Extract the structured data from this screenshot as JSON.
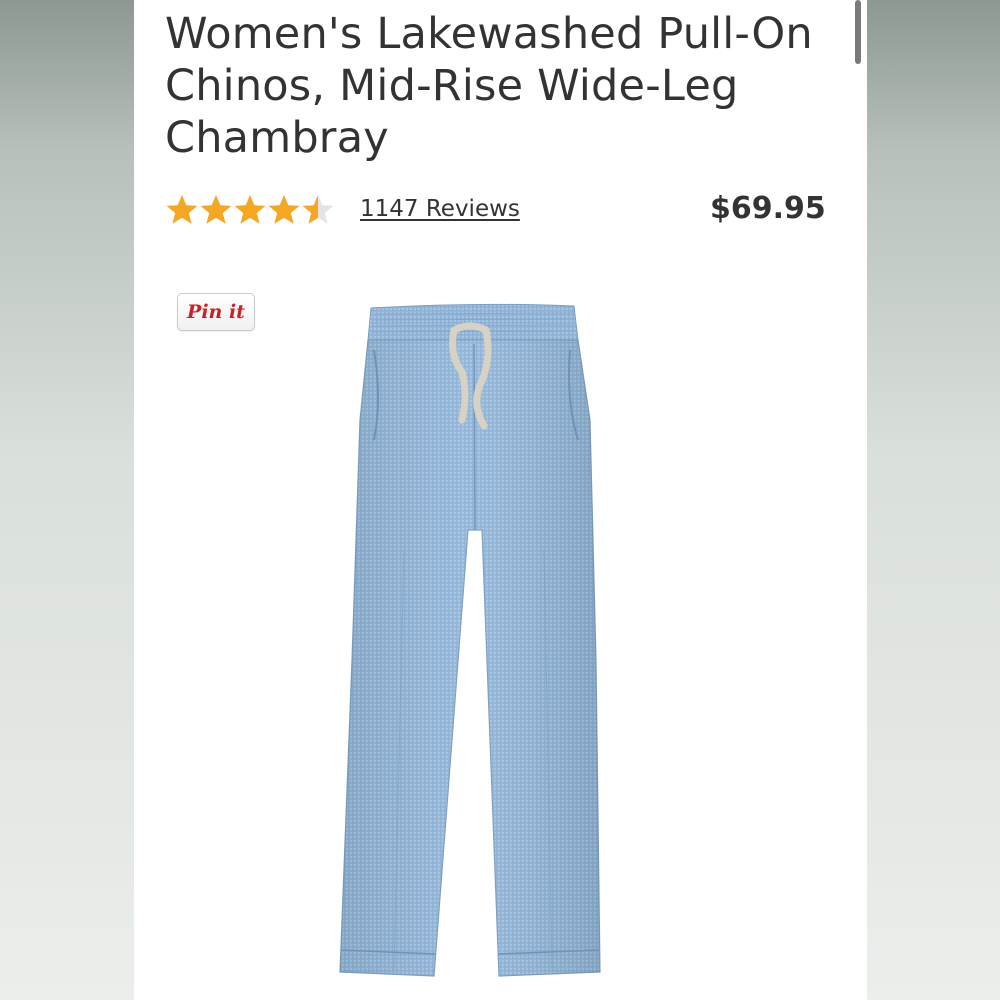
{
  "product": {
    "title": "Women's Lakewashed Pull-On Chinos, Mid-Rise Wide-Leg Chambray",
    "rating": 4.5,
    "rating_max": 5,
    "reviews_label": "1147 Reviews",
    "price": "$69.95",
    "image_icon": "pants-image"
  },
  "share": {
    "pin_label": "Pin it"
  },
  "colors": {
    "star": "#f5a623",
    "text": "#333333",
    "pin_red": "#cb2027",
    "chambray": "#8fb3d6"
  }
}
